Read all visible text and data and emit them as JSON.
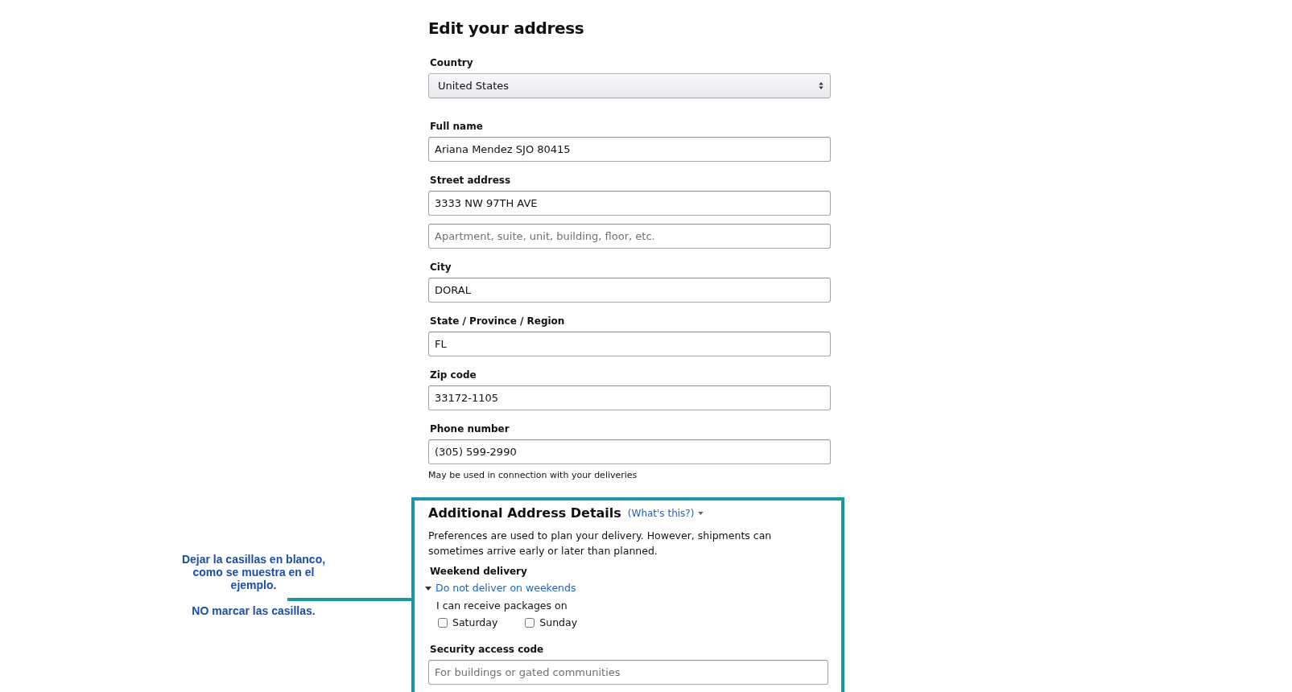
{
  "heading": "Edit your address",
  "fields": [
    {
      "kind": "select",
      "label": "Country",
      "value": "United States"
    },
    {
      "kind": "text",
      "label": "Full name",
      "value": "Ariana Mendez SJO 80415"
    },
    {
      "kind": "text",
      "label": "Street address",
      "value": "3333 NW 97TH AVE"
    },
    {
      "kind": "text",
      "placeholder": "Apartment, suite, unit, building, floor, etc."
    },
    {
      "kind": "text",
      "label": "City",
      "value": "DORAL"
    },
    {
      "kind": "text",
      "label": "State / Province / Region",
      "value": "FL"
    },
    {
      "kind": "text",
      "label": "Zip code",
      "value": "33172-1105"
    },
    {
      "kind": "text",
      "label": "Phone number",
      "value": "(305) 599-2990",
      "note": "May be used in connection with your deliveries"
    }
  ],
  "additional": {
    "heading": "Additional Address Details",
    "help_link": "(What's this?)",
    "description": "Preferences are used to plan your delivery. However, shipments can sometimes arrive early or later than planned.",
    "weekend": {
      "label": "Weekend delivery",
      "toggle": "Do not deliver on weekends",
      "expanded": true,
      "prompt": "I can receive packages on",
      "days": [
        {
          "label": "Saturday",
          "checked": false
        },
        {
          "label": "Sunday",
          "checked": false
        }
      ]
    },
    "security": {
      "label": "Security access code",
      "placeholder": "For buildings or gated communities"
    }
  },
  "annotation": {
    "paragraphs": [
      "Dejar la casillas en blanco, como se muestra en el ejemplo.",
      "NO marcar las casillas."
    ]
  }
}
